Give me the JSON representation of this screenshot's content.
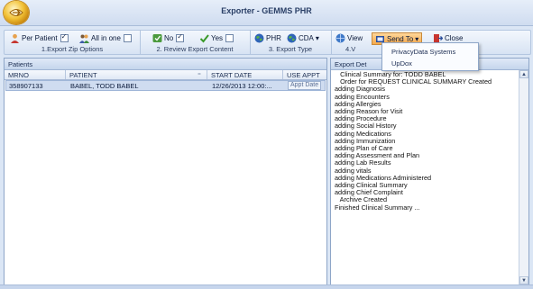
{
  "window": {
    "title": "Exporter - GEMMS PHR"
  },
  "ribbon": {
    "groups": [
      {
        "caption": "1.Export Zip Options"
      },
      {
        "caption": "2. Review Export Content"
      },
      {
        "caption": "3. Export Type"
      },
      {
        "caption": "4.V"
      }
    ],
    "per_patient": "Per Patient",
    "all_in_one": "All in one",
    "no": "No",
    "yes": "Yes",
    "phr": "PHR",
    "cda": "CDA",
    "cda_arrow": "▾",
    "view": "View",
    "send_to": "Send To",
    "send_to_arrow": "▾",
    "close": "Close"
  },
  "send_to_menu": {
    "items": [
      "PrivacyData Systems",
      "UpDox"
    ]
  },
  "patients": {
    "title": "Patients",
    "columns": [
      "MRNO",
      "PATIENT",
      "START DATE",
      "USE APPT"
    ],
    "rows": [
      {
        "mrno": "358907133",
        "patient": "BABEL, TODD BABEL",
        "start_date": "12/26/2013 12:00:...",
        "use_appt": "Appt Date"
      }
    ]
  },
  "export_details": {
    "title": "Export Det",
    "lines": [
      "   Clinical Summary for: TODD BABEL",
      "   Order for REQUEST CLINICAL SUMMARY Created",
      "adding Diagnosis",
      "adding Encounters",
      "adding Allergies",
      "adding Reason for Visit",
      "adding Procedure",
      "adding Social History",
      "adding Medications",
      "adding Immunization",
      "adding Plan of Care",
      "adding Assessment and Plan",
      "adding Lab Results",
      "adding vitals",
      "adding Medications Administered",
      "adding Clinical Summary",
      "adding Chief Complaint",
      "   Archive Created",
      "Finished Clinical Summary ..."
    ]
  },
  "colors": {
    "accent": "#f5a94c",
    "frame": "#8ea6c8",
    "selection": "#cfdcf0"
  }
}
